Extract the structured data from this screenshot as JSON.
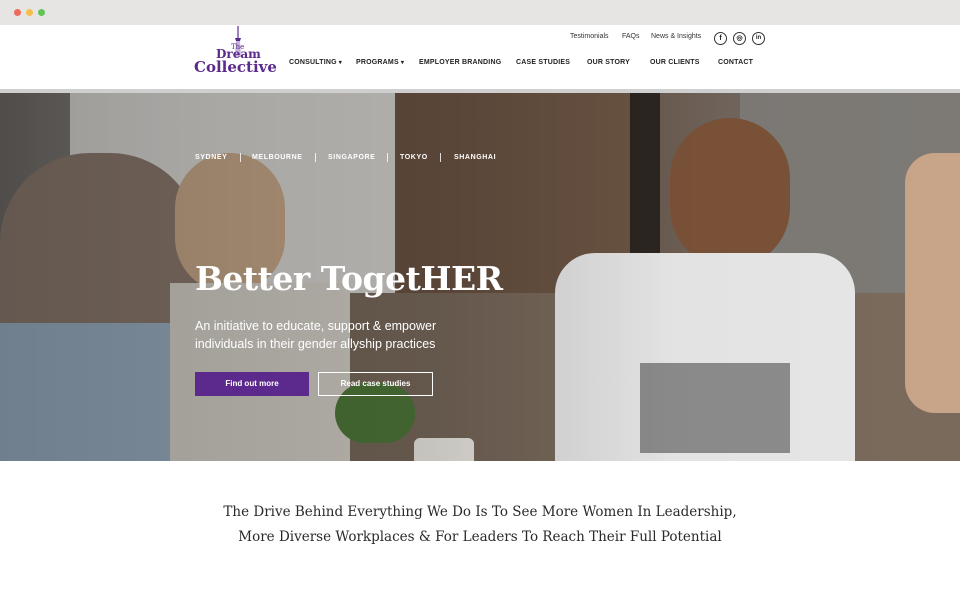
{
  "browser": {
    "window_controls": [
      "close",
      "minimize",
      "maximize"
    ]
  },
  "brand": {
    "logo_small": "The",
    "logo_line1": "Dream",
    "logo_line2": "Collective",
    "logo_color": "#5c2a8c"
  },
  "topnav": {
    "items": [
      "Testimonials",
      "FAQs",
      "News & Insights"
    ]
  },
  "social": {
    "items": [
      {
        "icon": "facebook-icon",
        "glyph": "f"
      },
      {
        "icon": "instagram-icon",
        "glyph": "◎"
      },
      {
        "icon": "linkedin-icon",
        "glyph": "in"
      }
    ]
  },
  "mainnav": {
    "items": [
      {
        "label": "CONSULTING",
        "dropdown": true
      },
      {
        "label": "PROGRAMS",
        "dropdown": true
      },
      {
        "label": "EMPLOYER BRANDING",
        "dropdown": false
      },
      {
        "label": "CASE STUDIES",
        "dropdown": false
      },
      {
        "label": "OUR STORY",
        "dropdown": false
      },
      {
        "label": "OUR CLIENTS",
        "dropdown": false
      },
      {
        "label": "CONTACT",
        "dropdown": false
      }
    ],
    "caret": "▾"
  },
  "hero": {
    "cities": [
      "SYDNEY",
      "MELBOURNE",
      "SINGAPORE",
      "TOKYO",
      "SHANGHAI"
    ],
    "title": "Better TogetHER",
    "subtitle": "An initiative to educate, support & empower individuals in their gender allyship practices",
    "primary_button": "Find out more",
    "secondary_button": "Read case studies",
    "accent_color": "#5c2a8c"
  },
  "tagline": {
    "line1": "The Drive Behind Everything We Do Is To See More Women In Leadership,",
    "line2": "More Diverse Workplaces & For Leaders To Reach Their Full Potential"
  }
}
